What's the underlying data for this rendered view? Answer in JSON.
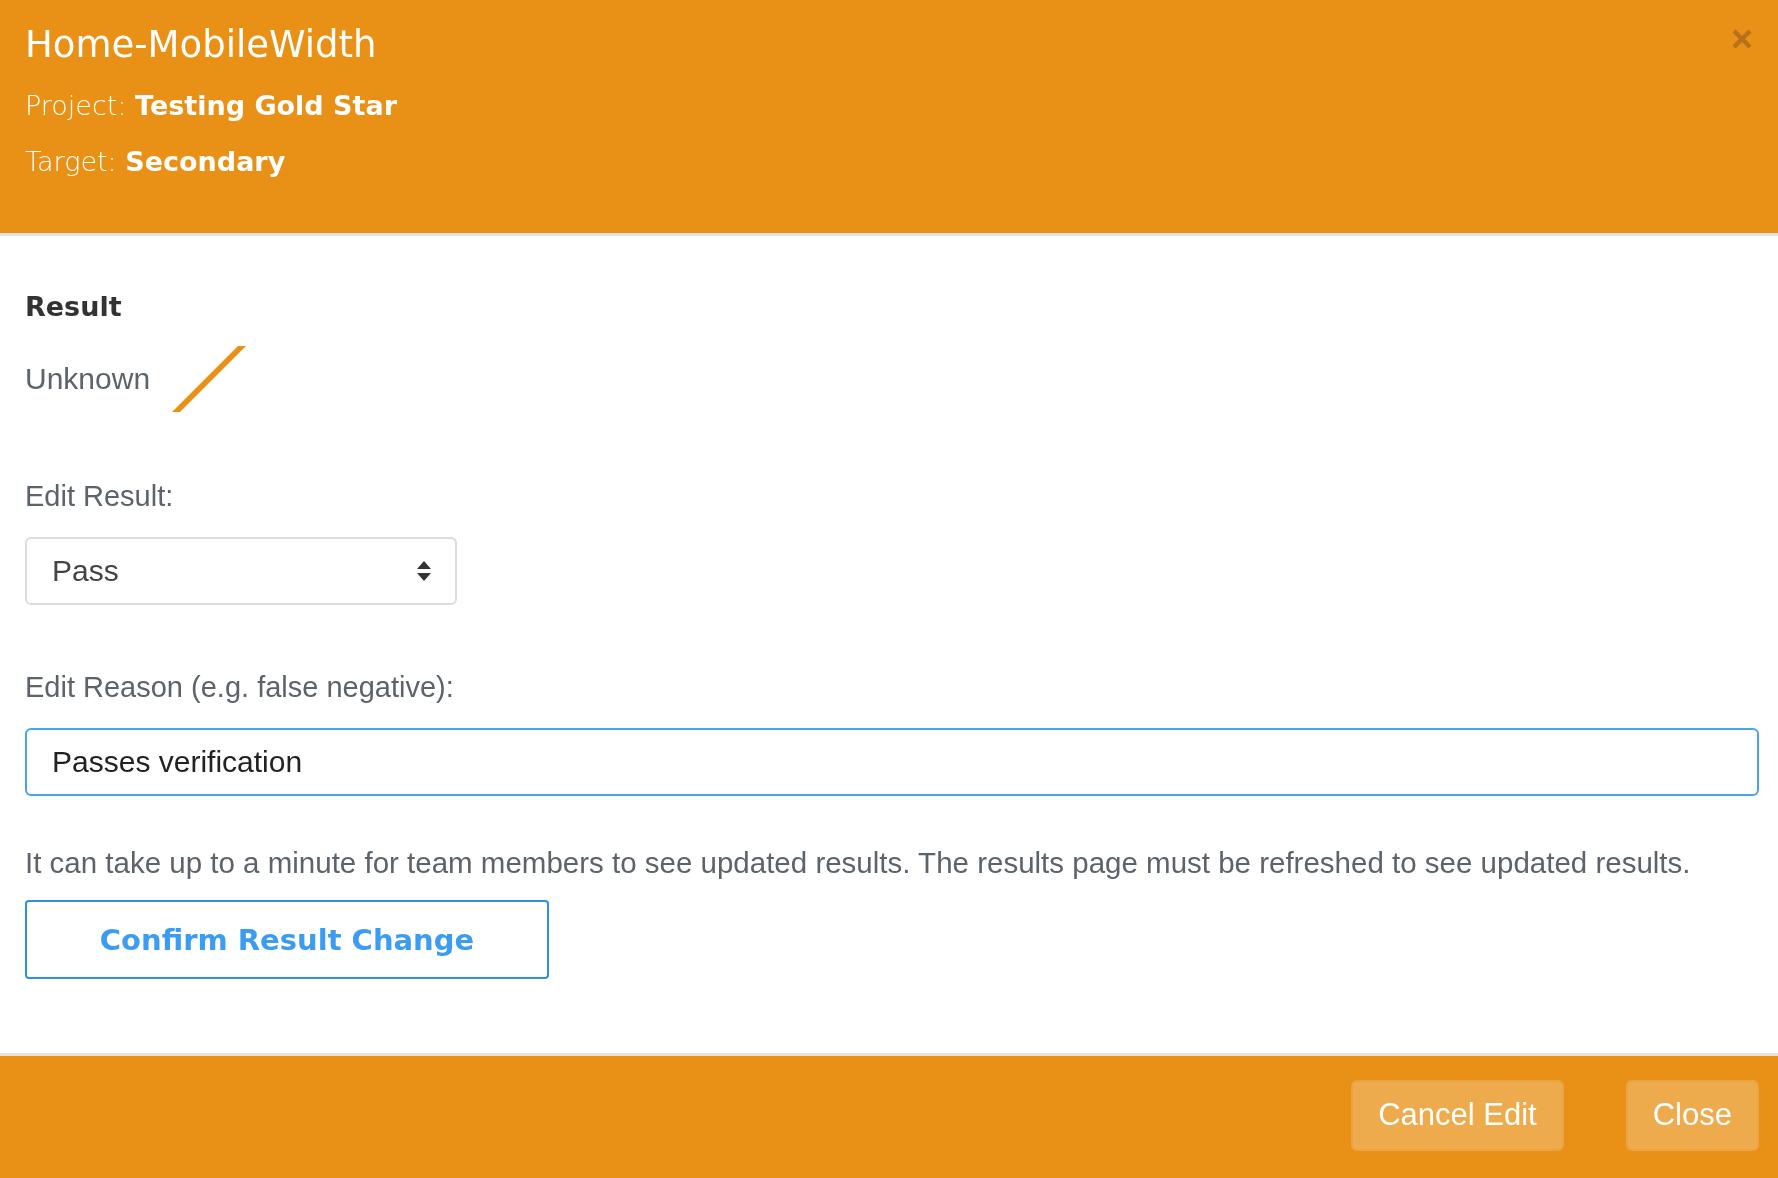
{
  "header": {
    "title": "Home-MobileWidth",
    "project": "Project: **Testing Gold Star**",
    "target": "Target: **Secondary**"
  },
  "result": {
    "heading": "Result",
    "status": "Unknown",
    "kind": "unknown"
  },
  "edit_result": {
    "label": "Edit Result:",
    "value": "Pass"
  },
  "edit_reason": {
    "label": "Edit Reason (e.g. false negative):",
    "value": "Passes verification"
  },
  "note": "It can take up to a minute for team members to see updated results. The results page must be refreshed to see updated results.",
  "confirm_button": "Confirm Result Change",
  "footer_buttons": [
    "Cancel Edit",
    "Close"
  ]
}
